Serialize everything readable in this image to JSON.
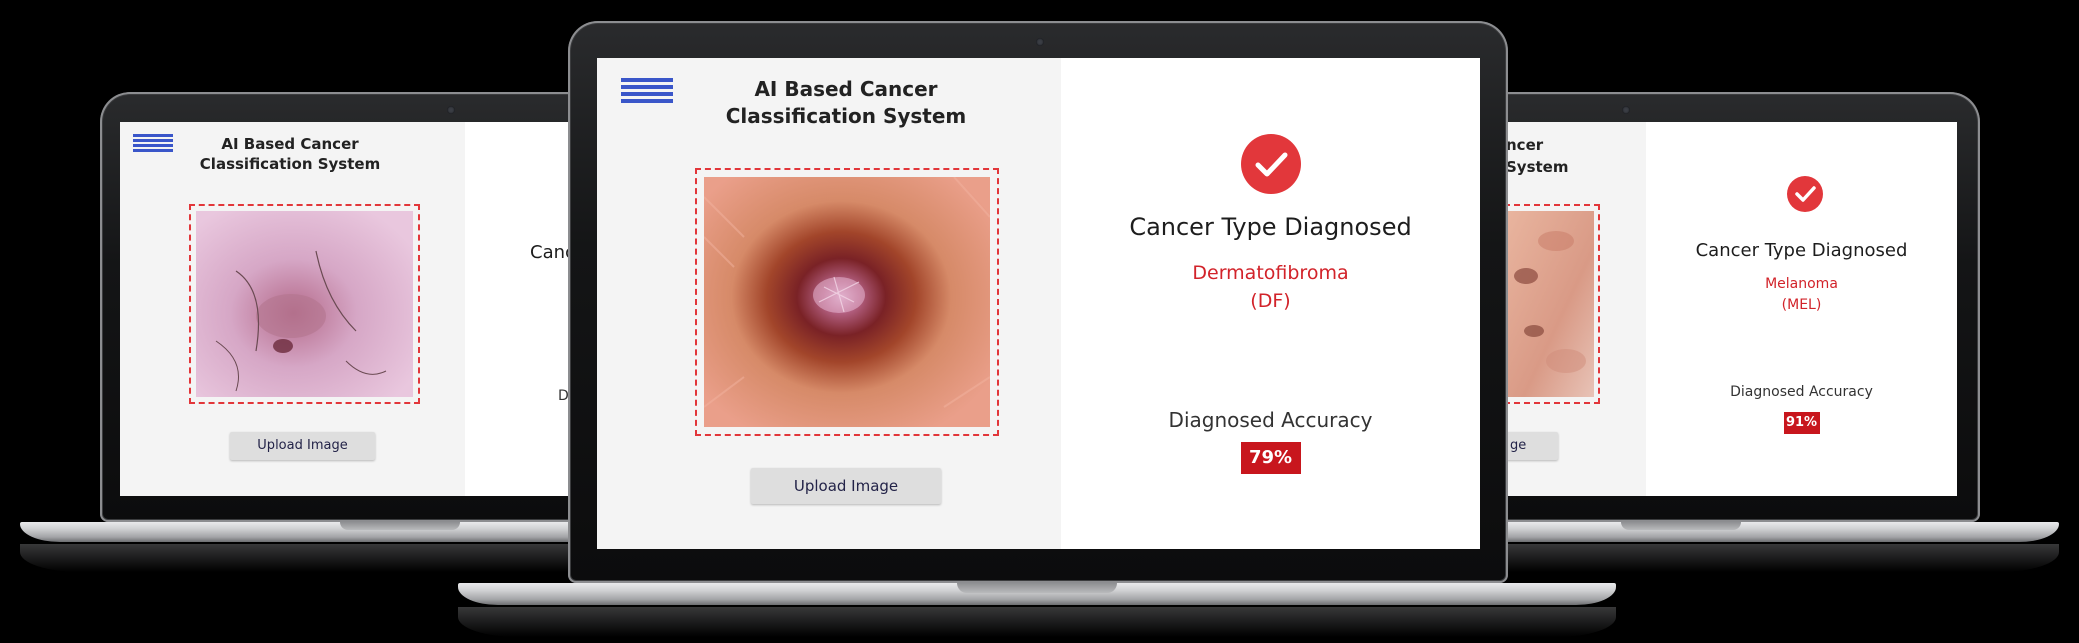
{
  "colors": {
    "accent": "#e2373b",
    "diagnosis_text": "#d2232a",
    "badge_bg": "#c8161d",
    "panel_left": "#f4f4f4"
  },
  "left_laptop": {
    "app_title_line1": "AI Based Cancer",
    "app_title_line2": "Classification System",
    "upload_label": "Upload Image",
    "visible_heading_fragment": "Canc",
    "visible_accuracy_fragment": "D"
  },
  "center_laptop": {
    "app_title_line1": "AI Based Cancer",
    "app_title_line2": "Classification System",
    "upload_label": "Upload Image",
    "result_heading": "Cancer Type Diagnosed",
    "diagnosis_name": "Dermatofibroma",
    "diagnosis_code": "(DF)",
    "accuracy_label": "Diagnosed Accuracy",
    "accuracy_value": "79%",
    "status_icon": "check-circle-icon"
  },
  "right_laptop": {
    "visible_title_fragment_1": "ncer",
    "visible_title_fragment_2": "System",
    "visible_upload_fragment": "ge",
    "result_heading": "Cancer Type Diagnosed",
    "diagnosis_name": "Melanoma",
    "diagnosis_code": "(MEL)",
    "accuracy_label": "Diagnosed Accuracy",
    "accuracy_value": "91%",
    "status_icon": "check-circle-icon"
  }
}
